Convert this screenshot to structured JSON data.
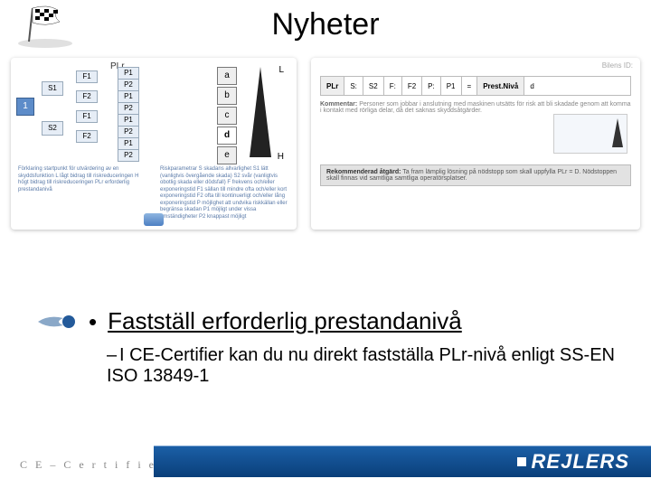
{
  "title": "Nyheter",
  "figA": {
    "pl_label": "PLr",
    "low": "L",
    "high": "H",
    "levels": [
      "a",
      "b",
      "c",
      "d",
      "e"
    ],
    "highlight": "d",
    "start": "1",
    "s_nodes": [
      "S1",
      "S2"
    ],
    "f_nodes": [
      "F1",
      "F2",
      "F1",
      "F2"
    ],
    "p_nodes": [
      "P1",
      "P2",
      "P1",
      "P2",
      "P1",
      "P2",
      "P1",
      "P2"
    ],
    "left_col": "Förklaring\nstartpunkt för utvärdering av en skyddsfunktion\nL   lågt bidrag till riskreduceringen\nH   högt bidrag till riskreduceringen\nPLr erforderlig prestandanivå",
    "right_col": "Riskparametrar\nS  skadans allvarlighet\nS1 lätt (vanligtvis övergående skada)\nS2 svår (vanligtvis obotlig skada eller dödsfall)\nF  frekvens och/eller exponeringstid\nF1 sällan till mindre ofta och/eller kort exponeringstid\nF2 ofta till kontinuerligt och/eller lång exponeringstid\nP  möjlighet att undvika riskkällan eller begränsa skadan\nP1 möjligt under vissa omständigheter\nP2 knappast möjligt"
  },
  "figB": {
    "title": "Bilens ID:",
    "row": {
      "plr": "PLr",
      "s": "S:",
      "sval": "S2",
      "f": "F:",
      "fval": "F2",
      "p": "P:",
      "pval": "P1",
      "eq": "=",
      "res": "Prest.Nivå",
      "resval": "d"
    },
    "comment_label": "Kommentar:",
    "comment": "Personer som jobbar i anslutning med maskinen utsätts för risk att bli skadade genom att komma i kontakt med rörliga delar, då det saknas skyddsåtgärder.",
    "rec_label": "Rekommenderad åtgärd:",
    "rec": "Ta fram lämplig lösning på nödstopp som skall uppfylla PLr = D. Nödstoppen skall finnas vid samtliga samtliga operatörsplatser."
  },
  "bullet": {
    "heading": "Fastställ erforderlig prestandanivå",
    "sub": "I CE-Certifier kan du nu direkt fastställa PLr-nivå enligt SS-EN ISO 13849-1"
  },
  "footer": {
    "ce": "C E – C e r t i f i e r",
    "brand": "REJLERS"
  }
}
